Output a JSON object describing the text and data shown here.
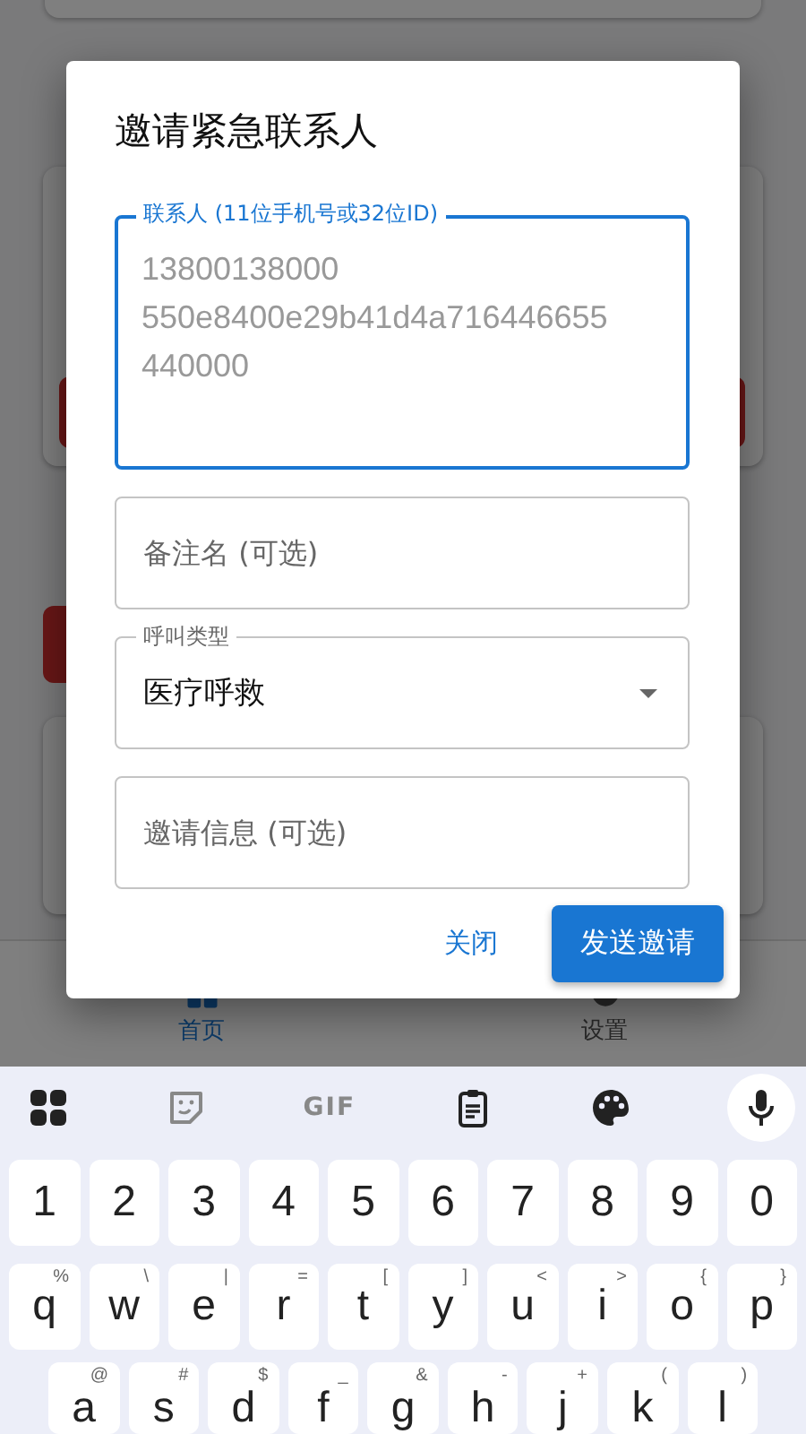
{
  "app": {
    "nav": [
      {
        "label": "首页",
        "kind": "home",
        "selected": true
      },
      {
        "label": "设置",
        "kind": "settings",
        "selected": false
      }
    ]
  },
  "dialog": {
    "title": "邀请紧急联系人",
    "fields": [
      {
        "kind": "textarea",
        "label": "联系人 (11位手机号或32位ID)",
        "placeholder": "13800138000\n550e8400e29b41d4a716446655440000",
        "focused": true
      },
      {
        "kind": "text",
        "placeholder": "备注名 (可选)",
        "focused": false
      },
      {
        "kind": "select",
        "label": "呼叫类型",
        "value": "医疗呼救",
        "focused": false
      },
      {
        "kind": "text",
        "placeholder": "邀请信息 (可选)",
        "focused": false
      }
    ],
    "buttons": [
      {
        "label": "关闭",
        "kind": "text"
      },
      {
        "label": "发送邀请",
        "kind": "filled"
      }
    ]
  },
  "keyboard": {
    "toolbar": [
      {
        "kind": "grid"
      },
      {
        "kind": "sticker"
      },
      {
        "kind": "gif",
        "label": "GIF"
      },
      {
        "kind": "clipboard"
      },
      {
        "kind": "palette"
      },
      {
        "kind": "mic"
      }
    ],
    "rows": [
      [
        {
          "key": "1"
        },
        {
          "key": "2"
        },
        {
          "key": "3"
        },
        {
          "key": "4"
        },
        {
          "key": "5"
        },
        {
          "key": "6"
        },
        {
          "key": "7"
        },
        {
          "key": "8"
        },
        {
          "key": "9"
        },
        {
          "key": "0"
        }
      ],
      [
        {
          "key": "q",
          "hint": "%"
        },
        {
          "key": "w",
          "hint": "\\"
        },
        {
          "key": "e",
          "hint": "|"
        },
        {
          "key": "r",
          "hint": "="
        },
        {
          "key": "t",
          "hint": "["
        },
        {
          "key": "y",
          "hint": "]"
        },
        {
          "key": "u",
          "hint": "<"
        },
        {
          "key": "i",
          "hint": ">"
        },
        {
          "key": "o",
          "hint": "{"
        },
        {
          "key": "p",
          "hint": "}"
        }
      ],
      [
        {
          "key": "a",
          "hint": "@"
        },
        {
          "key": "s",
          "hint": "#"
        },
        {
          "key": "d",
          "hint": "$"
        },
        {
          "key": "f",
          "hint": "_"
        },
        {
          "key": "g",
          "hint": "&"
        },
        {
          "key": "h",
          "hint": "-"
        },
        {
          "key": "j",
          "hint": "+"
        },
        {
          "key": "k",
          "hint": "("
        },
        {
          "key": "l",
          "hint": ")"
        }
      ]
    ]
  }
}
